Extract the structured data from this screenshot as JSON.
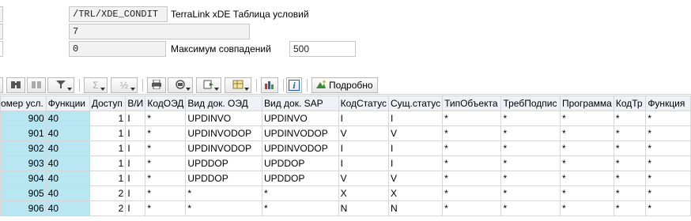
{
  "header": {
    "table_field_value": "/TRL/XDE_CONDIT",
    "table_description": "TerraLink xDE Таблица условий",
    "count_field_value": "7",
    "offset_field_value": "0",
    "max_hits_label": "Максимум совпадений",
    "max_hits_value": "500"
  },
  "toolbar": {
    "detail_label": "Подробно",
    "info_label": "i"
  },
  "table": {
    "columns": [
      "омер усл.",
      "Функции",
      "Доступ",
      "В/И",
      "КодОЭД",
      "Вид док. ОЭД",
      "Вид док. SAP",
      "КодСтатус",
      "Сущ.статус",
      "ТипОбъекта",
      "ТребПодпис",
      "Программа",
      "КодТр",
      "Функция"
    ],
    "rows": [
      [
        "900",
        "40",
        "1",
        "I",
        "*",
        "UPDINVO",
        "UPDINVO",
        "I",
        "I",
        "*",
        "*",
        "*",
        "*",
        "*"
      ],
      [
        "901",
        "40",
        "1",
        "I",
        "*",
        "UPDINVODOP",
        "UPDINVODOP",
        "V",
        "V",
        "*",
        "*",
        "*",
        "*",
        "*"
      ],
      [
        "902",
        "40",
        "1",
        "I",
        "*",
        "UPDINVODOP",
        "UPDINVODOP",
        "I",
        "I",
        "*",
        "*",
        "*",
        "*",
        "*"
      ],
      [
        "903",
        "40",
        "1",
        "I",
        "*",
        "UPDDOP",
        "UPDDOP",
        "I",
        "I",
        "*",
        "*",
        "*",
        "*",
        "*"
      ],
      [
        "904",
        "40",
        "1",
        "I",
        "*",
        "UPDDOP",
        "UPDDOP",
        "V",
        "V",
        "*",
        "*",
        "*",
        "*",
        "*"
      ],
      [
        "905",
        "40",
        "2",
        "I",
        "*",
        "*",
        "*",
        "X",
        "X",
        "*",
        "*",
        "*",
        "*",
        "*"
      ],
      [
        "906",
        "40",
        "2",
        "I",
        "*",
        "*",
        "*",
        "N",
        "N",
        "*",
        "*",
        "*",
        "*",
        "*"
      ]
    ]
  }
}
